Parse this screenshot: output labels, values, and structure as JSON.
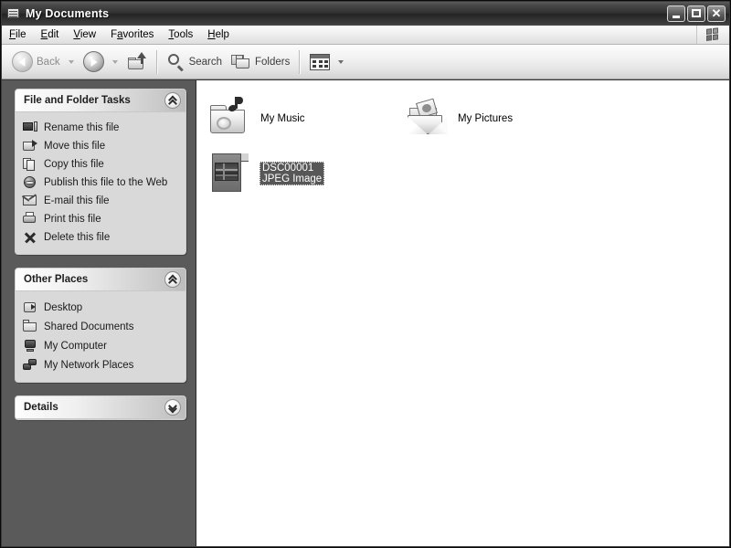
{
  "window": {
    "title": "My Documents",
    "icon": "documents-folder-icon",
    "controls": {
      "minimize": "Minimize",
      "maximize": "Maximize",
      "close": "Close"
    }
  },
  "menubar": {
    "items": [
      {
        "label": "File",
        "accel": "F"
      },
      {
        "label": "Edit",
        "accel": "E"
      },
      {
        "label": "View",
        "accel": "V"
      },
      {
        "label": "Favorites",
        "accel": "a"
      },
      {
        "label": "Tools",
        "accel": "T"
      },
      {
        "label": "Help",
        "accel": "H"
      }
    ],
    "brand_icon": "windows-flag-icon"
  },
  "toolbar": {
    "back_label": "Back",
    "forward_label": "",
    "up_label": "Up",
    "search_label": "Search",
    "folders_label": "Folders",
    "views_label": "Views"
  },
  "sidebar": {
    "panels": [
      {
        "title": "File and Folder Tasks",
        "collapsed": false,
        "chevron": "chevron-up-icon",
        "items": [
          {
            "label": "Rename this file",
            "icon": "rename-icon"
          },
          {
            "label": "Move this file",
            "icon": "move-icon"
          },
          {
            "label": "Copy this file",
            "icon": "copy-icon"
          },
          {
            "label": "Publish this file to the Web",
            "icon": "publish-web-icon"
          },
          {
            "label": "E-mail this file",
            "icon": "email-icon"
          },
          {
            "label": "Print this file",
            "icon": "print-icon"
          },
          {
            "label": "Delete this file",
            "icon": "delete-icon"
          }
        ]
      },
      {
        "title": "Other Places",
        "collapsed": false,
        "chevron": "chevron-up-icon",
        "items": [
          {
            "label": "Desktop",
            "icon": "desktop-icon"
          },
          {
            "label": "Shared Documents",
            "icon": "shared-folder-icon"
          },
          {
            "label": "My Computer",
            "icon": "my-computer-icon"
          },
          {
            "label": "My Network Places",
            "icon": "network-places-icon"
          }
        ]
      },
      {
        "title": "Details",
        "collapsed": true,
        "chevron": "chevron-down-icon",
        "items": []
      }
    ]
  },
  "files": {
    "view": "Tiles",
    "items": [
      {
        "name": "My Music",
        "subtitle": "",
        "icon": "music-folder-icon",
        "selected": false
      },
      {
        "name": "My Pictures",
        "subtitle": "",
        "icon": "pictures-folder-icon",
        "selected": false
      },
      {
        "name": "DSC00001",
        "subtitle": "JPEG Image",
        "icon": "jpeg-file-icon",
        "selected": true
      }
    ]
  },
  "colors": {
    "titlebar": "#2c2c2c",
    "sidebar_bg": "#5a5a5a",
    "panel_bg": "#d9d9d9",
    "selection": "#575757",
    "content_bg": "#ffffff"
  }
}
